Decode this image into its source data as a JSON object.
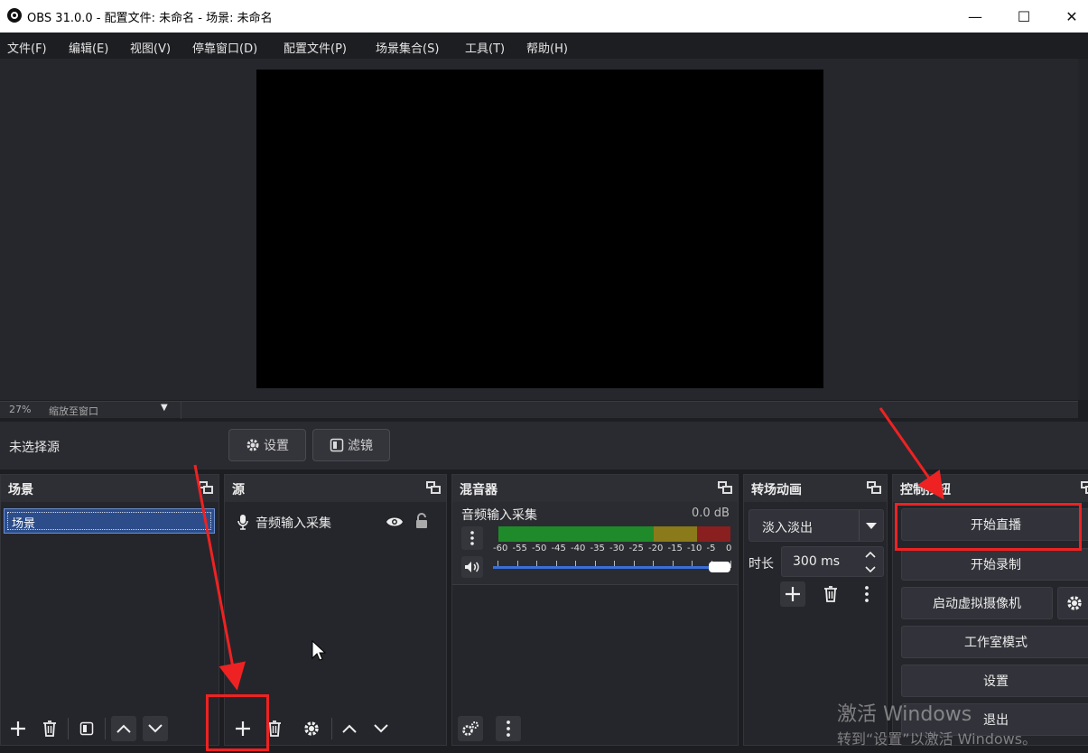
{
  "window": {
    "title": "OBS 31.0.0 - 配置文件: 未命名 - 场景: 未命名",
    "min_glyph": "—",
    "max_glyph": "☐",
    "close_glyph": "✕"
  },
  "menu": [
    "文件(F)",
    "编辑(E)",
    "视图(V)",
    "停靠窗口(D)",
    "配置文件(P)",
    "场景集合(S)",
    "工具(T)",
    "帮助(H)"
  ],
  "preview": {
    "zoom": "27%",
    "zoom_mode": "缩放至窗口",
    "dropdown_glyph": "▼"
  },
  "context": {
    "no_source": "未选择源",
    "settings_label": "设置",
    "filters_label": "滤镜"
  },
  "scenes": {
    "title": "场景",
    "items": [
      "场景"
    ]
  },
  "sources": {
    "title": "源",
    "items": [
      {
        "name": "音频输入采集"
      }
    ]
  },
  "mixer": {
    "title": "混音器",
    "channel": "音频输入采集",
    "db": "0.0 dB",
    "scale": [
      "-60",
      "-55",
      "-50",
      "-45",
      "-40",
      "-35",
      "-30",
      "-25",
      "-20",
      "-15",
      "-10",
      "-5",
      "0"
    ],
    "volume": 1.0
  },
  "transitions": {
    "title": "转场动画",
    "selected": "淡入淡出",
    "duration_label": "时长",
    "duration": "300 ms"
  },
  "controls": {
    "title": "控制按钮",
    "start_stream": "开始直播",
    "start_record": "开始录制",
    "virtual_cam": "启动虚拟摄像机",
    "studio_mode": "工作室模式",
    "settings": "设置",
    "exit": "退出"
  },
  "watermark": {
    "line1": "激活 Windows",
    "line2": "转到“设置”以激活 Windows。"
  },
  "colors": {
    "annotation": "#ee2222",
    "mixer_green": "#1f8a2a",
    "mixer_yellow": "#8a7a1a",
    "mixer_red": "#8a1f1f",
    "slider": "#3b6ed8"
  }
}
